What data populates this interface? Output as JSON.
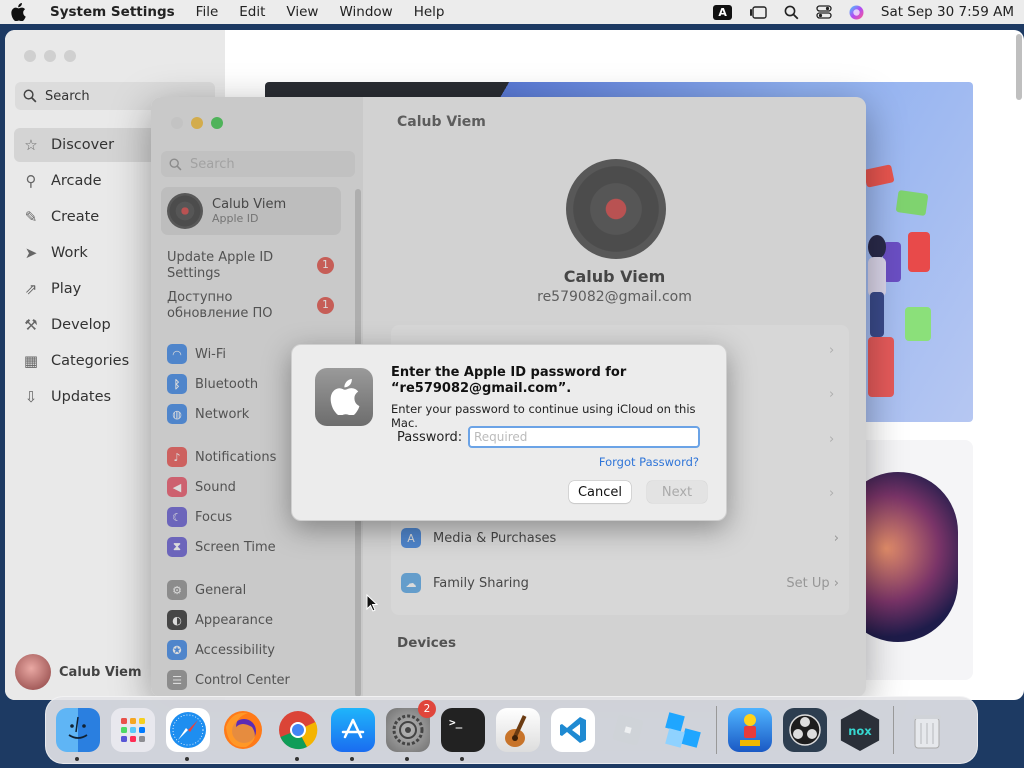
{
  "menubar": {
    "app_name": "System Settings",
    "menus": [
      "File",
      "Edit",
      "View",
      "Window",
      "Help"
    ],
    "input_source": "A",
    "datetime": "Sat Sep 30  7:59 AM"
  },
  "appstore": {
    "search_placeholder": "Search",
    "nav": [
      {
        "label": "Discover",
        "icon": "star-icon"
      },
      {
        "label": "Arcade",
        "icon": "joystick-icon"
      },
      {
        "label": "Create",
        "icon": "brush-icon"
      },
      {
        "label": "Work",
        "icon": "paperplane-icon"
      },
      {
        "label": "Play",
        "icon": "rocket-icon"
      },
      {
        "label": "Develop",
        "icon": "hammer-icon"
      },
      {
        "label": "Categories",
        "icon": "grid-icon"
      },
      {
        "label": "Updates",
        "icon": "download-icon"
      }
    ],
    "user_name": "Calub Viem"
  },
  "settings": {
    "window_title": "Calub Viem",
    "search_placeholder": "Search",
    "account": {
      "name": "Calub Viem",
      "subtitle": "Apple ID"
    },
    "notices": [
      {
        "label": "Update Apple ID Settings",
        "badge": "1"
      },
      {
        "label": "Доступно обновление ПО",
        "badge": "1"
      }
    ],
    "groups": [
      [
        "Wi-Fi",
        "Bluetooth",
        "Network"
      ],
      [
        "Notifications",
        "Sound",
        "Focus",
        "Screen Time"
      ],
      [
        "General",
        "Appearance",
        "Accessibility",
        "Control Center"
      ]
    ],
    "main": {
      "name": "Calub Viem",
      "email": "re579082@gmail.com",
      "rows": [
        {
          "label": "Media & Purchases",
          "value": ""
        },
        {
          "label": "Family Sharing",
          "value": "Set Up"
        }
      ],
      "devices_heading": "Devices"
    }
  },
  "dialog": {
    "title": "Enter the Apple ID password for “re579082@gmail.com”.",
    "subtitle": "Enter your password to continue using iCloud on this Mac.",
    "password_label": "Password:",
    "password_placeholder": "Required",
    "password_value": "",
    "forgot_label": "Forgot Password?",
    "cancel_label": "Cancel",
    "next_label": "Next"
  },
  "dock": {
    "apps": [
      {
        "name": "finder-icon",
        "running": true
      },
      {
        "name": "launchpad-icon",
        "running": false
      },
      {
        "name": "safari-icon",
        "running": true
      },
      {
        "name": "firefox-icon",
        "running": false
      },
      {
        "name": "chrome-icon",
        "running": true
      },
      {
        "name": "app-store-icon",
        "running": true
      },
      {
        "name": "system-settings-icon",
        "running": true,
        "badge": "2"
      },
      {
        "name": "terminal-icon",
        "running": true
      },
      {
        "name": "garageband-icon",
        "running": false
      },
      {
        "name": "vscode-icon",
        "running": false
      },
      {
        "name": "roblox-icon",
        "running": false
      },
      {
        "name": "roblox-studio-icon",
        "running": false
      },
      {
        "name": "subway-surfers-icon",
        "running": false
      },
      {
        "name": "obs-icon",
        "running": false
      },
      {
        "name": "nox-icon",
        "running": false
      },
      {
        "name": "trash-icon",
        "running": false
      }
    ]
  },
  "colors": {
    "accent": "#2f75d8",
    "badge": "#e0453b",
    "focus_ring": "#6ba3e6"
  }
}
